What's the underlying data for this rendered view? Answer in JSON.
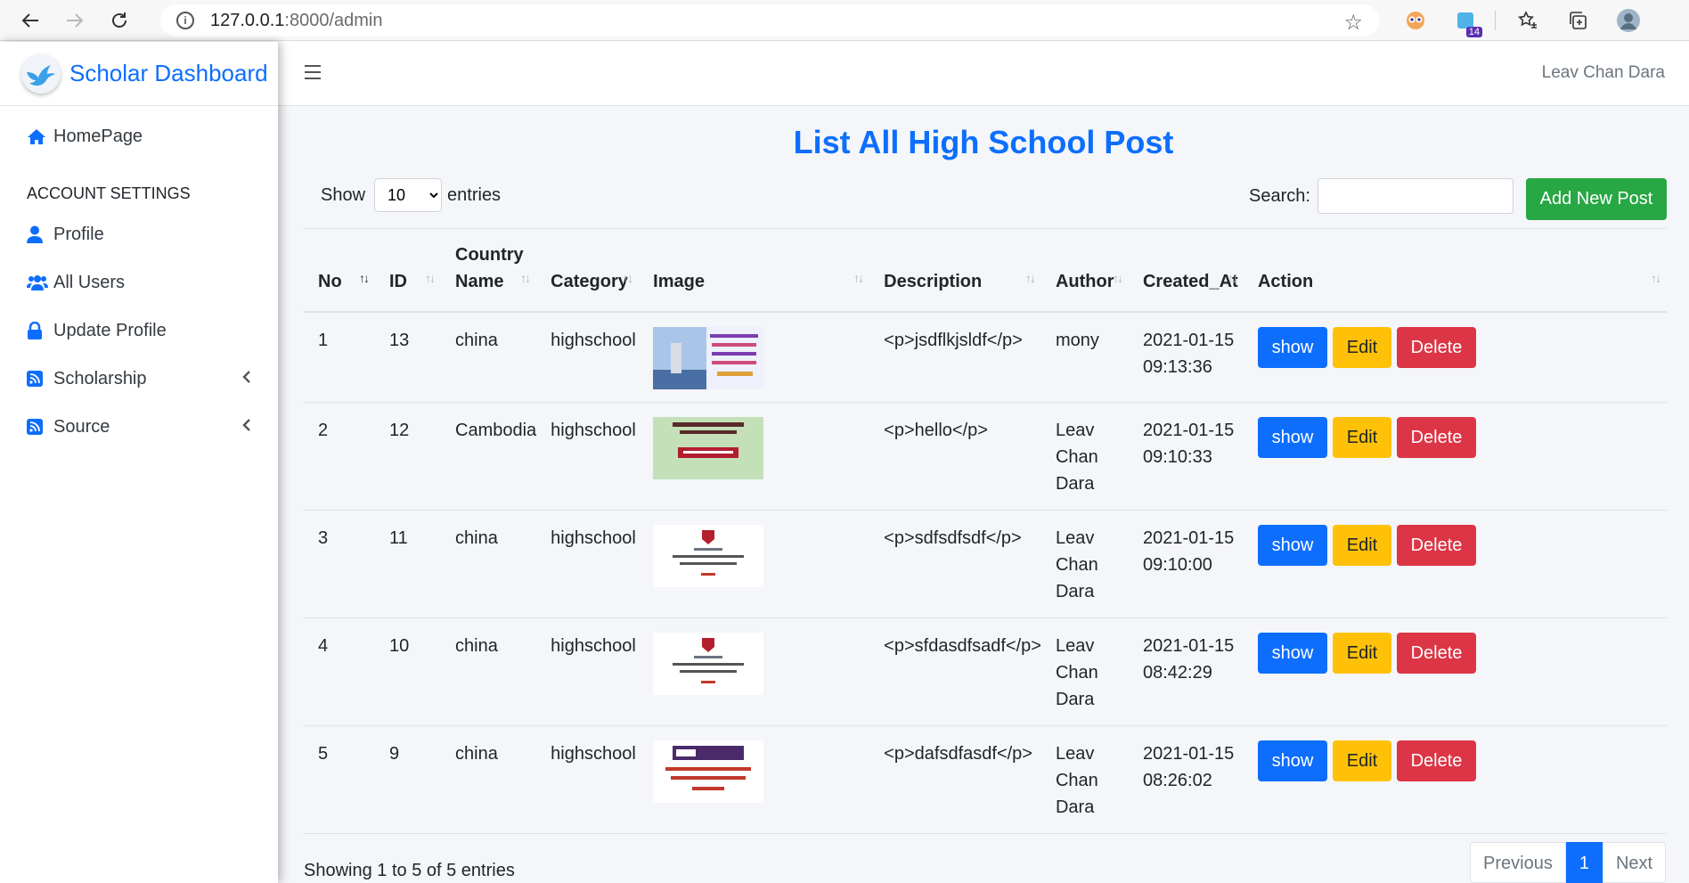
{
  "browser": {
    "url_host": "127.0.0.1",
    "url_rest": ":8000/admin",
    "extension_badge": "14"
  },
  "sidebar": {
    "brand": "Scholar Dashboard",
    "home": "HomePage",
    "section_header": "ACCOUNT SETTINGS",
    "items": [
      {
        "label": "Profile",
        "icon": "user-icon"
      },
      {
        "label": "All Users",
        "icon": "users-icon"
      },
      {
        "label": "Update Profile",
        "icon": "lock-icon"
      },
      {
        "label": "Scholarship",
        "icon": "rss-icon"
      },
      {
        "label": "Source",
        "icon": "rss-icon"
      }
    ]
  },
  "topbar": {
    "user": "Leav Chan Dara"
  },
  "main": {
    "title": "List All High School Post",
    "show_label": "Show",
    "show_value": "10",
    "entries_label": "entries",
    "search_label": "Search:",
    "search_value": "",
    "add_button": "Add New Post",
    "columns": [
      "No",
      "ID",
      "Country Name",
      "Category",
      "Image",
      "Description",
      "Author",
      "Created_At",
      "Action"
    ],
    "rows": [
      {
        "no": "1",
        "id": "13",
        "country": "china",
        "category": "highschool",
        "description": "<p>jsdflkjsldf</p>",
        "author": "mony",
        "created": "2021-01-15 09:13:36"
      },
      {
        "no": "2",
        "id": "12",
        "country": "Cambodia",
        "category": "highschool",
        "description": "<p>hello</p>",
        "author": "Leav Chan Dara",
        "created": "2021-01-15 09:10:33"
      },
      {
        "no": "3",
        "id": "11",
        "country": "china",
        "category": "highschool",
        "description": "<p>sdfsdfsdf</p>",
        "author": "Leav Chan Dara",
        "created": "2021-01-15 09:10:00"
      },
      {
        "no": "4",
        "id": "10",
        "country": "china",
        "category": "highschool",
        "description": "<p>sfdasdfsadf</p>",
        "author": "Leav Chan Dara",
        "created": "2021-01-15 08:42:29"
      },
      {
        "no": "5",
        "id": "9",
        "country": "china",
        "category": "highschool",
        "description": "<p>dafsdfasdf</p>",
        "author": "Leav Chan Dara",
        "created": "2021-01-15 08:26:02"
      }
    ],
    "actions": {
      "show": "show",
      "edit": "Edit",
      "delete": "Delete"
    },
    "info": "Showing 1 to 5 of 5 entries",
    "pagination": {
      "previous": "Previous",
      "current": "1",
      "next": "Next"
    }
  },
  "colors": {
    "primary": "#0d6efd",
    "success": "#28a745",
    "warning": "#ffc107",
    "danger": "#dc3545"
  }
}
